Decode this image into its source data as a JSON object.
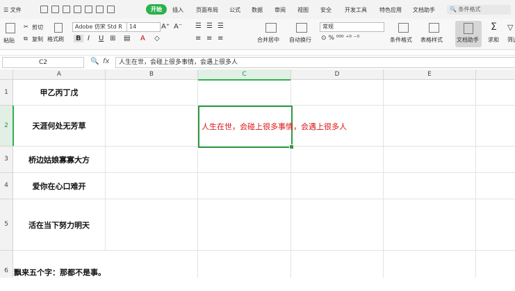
{
  "menubar": {
    "file": "☰ 文件",
    "active_tab": "开始",
    "tabs": [
      "插入",
      "页面布局",
      "公式",
      "数据",
      "审阅",
      "视图",
      "安全",
      "开发工具",
      "特色应用",
      "文档助手"
    ],
    "search_placeholder": "条件格式"
  },
  "ribbon": {
    "paste": "粘贴",
    "cut": "剪切",
    "copy": "复制",
    "format_painter": "格式刷",
    "font_name": "Adobe 仿宋 Std R",
    "font_size": "14",
    "bold": "B",
    "italic": "I",
    "underline": "U",
    "merge": "合并居中",
    "wrap": "自动换行",
    "number_format": "常规",
    "conditional_format": "条件格式",
    "table_style": "表格样式",
    "doc_helper": "文档助手",
    "sum": "求和",
    "filter": "筛选"
  },
  "formula_bar": {
    "cell_ref": "C2",
    "fx": "fx",
    "content": "人生在世，会碰上很多事情，会遇上很多人"
  },
  "sheet": {
    "columns": [
      "A",
      "B",
      "C",
      "D",
      "E"
    ],
    "rows": [
      "1",
      "2",
      "3",
      "4",
      "5",
      "6"
    ],
    "cells": {
      "A1": "甲乙丙丁戊",
      "A2": "天涯何处无芳草",
      "A3": "桥边姑娘寡寡大方",
      "A4": "爱你在心口难开",
      "A5": "活在当下努力明天",
      "A6": "飘来五个字：那都不是事。",
      "C2": "人生在世，会碰上很多事情，会遇上很多人"
    },
    "selected_cell": "C2",
    "overflow_color": "#dd1111"
  }
}
